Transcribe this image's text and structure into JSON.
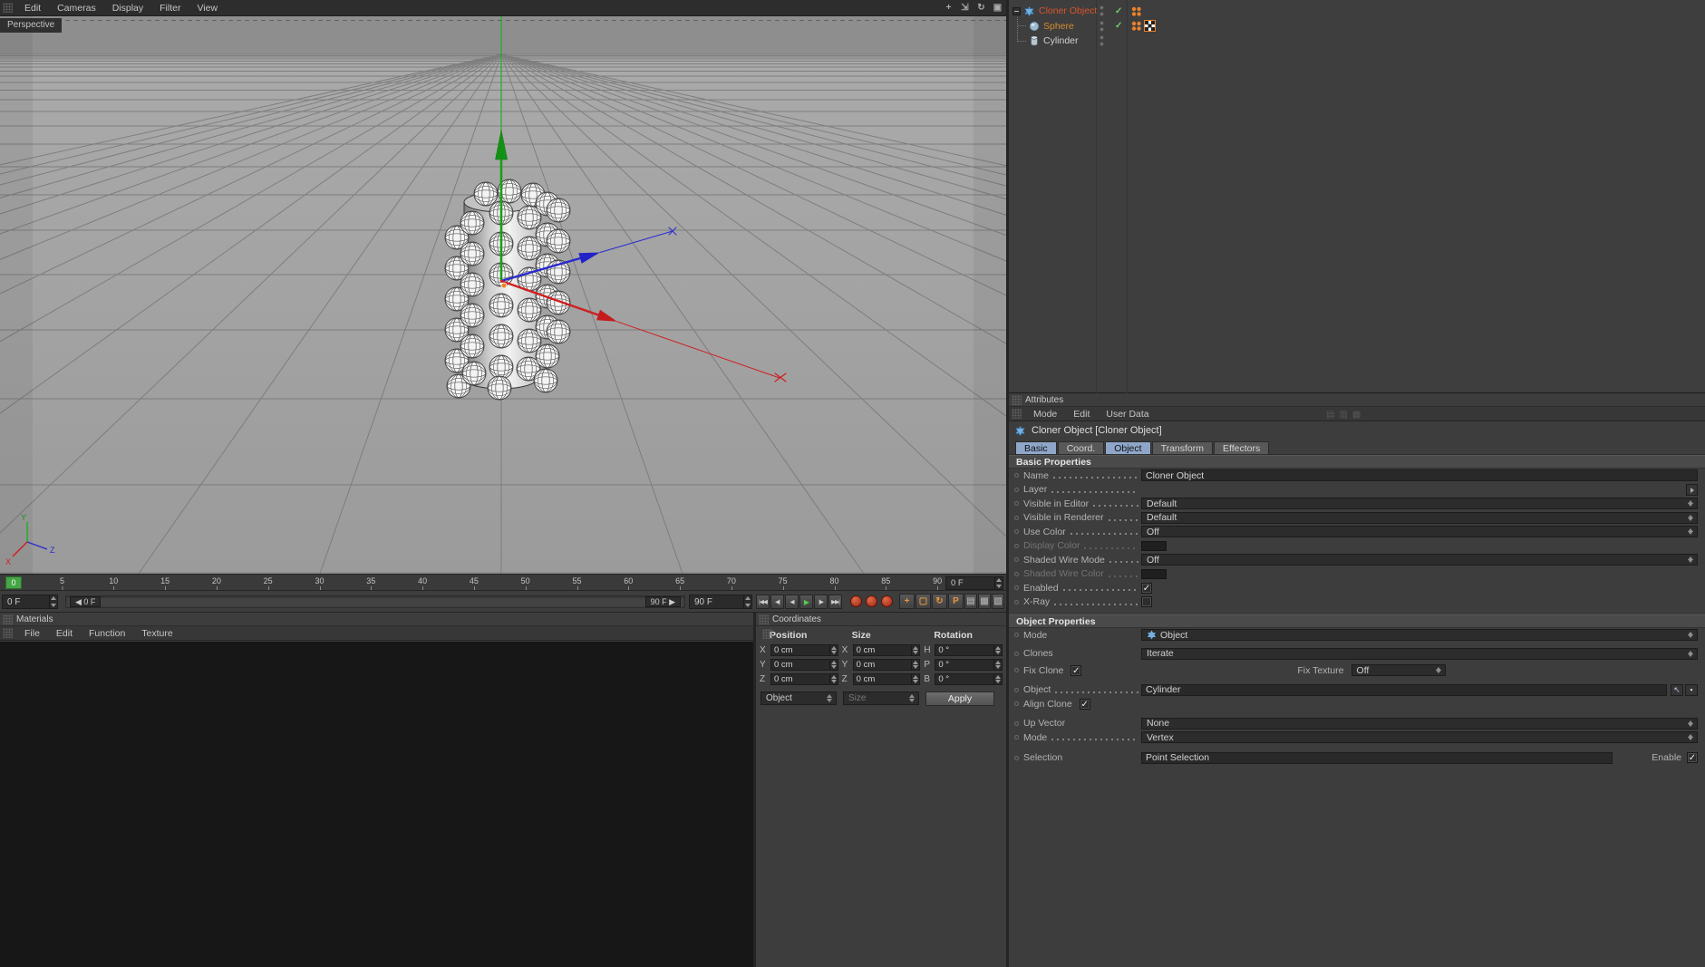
{
  "viewport": {
    "menu": [
      {
        "name": "edit",
        "label": "Edit"
      },
      {
        "name": "cameras",
        "label": "Cameras"
      },
      {
        "name": "display",
        "label": "Display"
      },
      {
        "name": "filter",
        "label": "Filter"
      },
      {
        "name": "view",
        "label": "View"
      }
    ],
    "view_label": "Perspective",
    "axis_labels": {
      "x": "X",
      "y": "Y",
      "z": "Z"
    },
    "nav_icons": [
      {
        "name": "pan-icon",
        "glyph": "+"
      },
      {
        "name": "zoom-icon",
        "glyph": "⇲"
      },
      {
        "name": "rotate-icon",
        "glyph": "↻"
      },
      {
        "name": "toggle-view-icon",
        "glyph": "▣"
      }
    ]
  },
  "object_manager": {
    "items": [
      {
        "name": "cloner-object",
        "label": "Cloner Object",
        "color": "#d8552a"
      },
      {
        "name": "sphere",
        "label": "Sphere",
        "color": "#d68c2e"
      },
      {
        "name": "cylinder",
        "label": "Cylinder",
        "color": "#d2d2d2"
      }
    ],
    "check": "✓"
  },
  "timeline": {
    "marker_label": "0",
    "ticks": [
      "5",
      "10",
      "15",
      "20",
      "25",
      "30",
      "35",
      "40",
      "45",
      "50",
      "55",
      "60",
      "65",
      "70",
      "75",
      "80",
      "85",
      "90"
    ],
    "ruler_frame": "0 F",
    "current_frame": "0 F",
    "range_start": "◀ 0 F",
    "range_end": "90 F ▶",
    "end_frame": "90 F",
    "transport": [
      {
        "name": "goto-start-button",
        "glyph": "|◀◀"
      },
      {
        "name": "prev-key-button",
        "glyph": "◀|"
      },
      {
        "name": "prev-frame-button",
        "glyph": "◀"
      },
      {
        "name": "play-button",
        "glyph": "▶",
        "accent": true
      },
      {
        "name": "next-frame-button",
        "glyph": "|▶"
      },
      {
        "name": "goto-end-button",
        "glyph": "▶▶|"
      }
    ],
    "record_buttons": [
      {
        "name": "record-keyframe-button"
      },
      {
        "name": "autokeying-button"
      },
      {
        "name": "keyframe-selection-button"
      }
    ],
    "record_toggles": [
      {
        "name": "record-position-toggle",
        "glyph": "+"
      },
      {
        "name": "record-scale-toggle",
        "glyph": "▢"
      },
      {
        "name": "record-rotation-toggle",
        "glyph": "↻"
      },
      {
        "name": "record-parameter-toggle",
        "glyph": "P"
      }
    ],
    "extra_toggles": [
      {
        "name": "motion-mode-icon",
        "glyph": "▤"
      },
      {
        "name": "key-interpolation-icon",
        "glyph": "▦"
      },
      {
        "name": "timeline-options-icon",
        "glyph": "▧"
      }
    ]
  },
  "materials": {
    "title": "Materials",
    "menu": [
      {
        "name": "file",
        "label": "File"
      },
      {
        "name": "edit",
        "label": "Edit"
      },
      {
        "name": "function",
        "label": "Function"
      },
      {
        "name": "texture",
        "label": "Texture"
      }
    ]
  },
  "coordinates": {
    "title": "Coordinates",
    "columns": [
      {
        "header": "Position",
        "rows": [
          {
            "axis": "X",
            "value": "0 cm"
          },
          {
            "axis": "Y",
            "value": "0 cm"
          },
          {
            "axis": "Z",
            "value": "0 cm"
          }
        ]
      },
      {
        "header": "Size",
        "rows": [
          {
            "axis": "X",
            "value": "0 cm"
          },
          {
            "axis": "Y",
            "value": "0 cm"
          },
          {
            "axis": "Z",
            "value": "0 cm"
          }
        ]
      },
      {
        "header": "Rotation",
        "rows": [
          {
            "axis": "H",
            "value": "0 °"
          },
          {
            "axis": "P",
            "value": "0 °"
          },
          {
            "axis": "B",
            "value": "0 °"
          }
        ]
      }
    ],
    "object_dropdown": "Object",
    "size_dropdown": "Size",
    "apply_button": "Apply"
  },
  "attributes": {
    "title": "Attributes",
    "menu": [
      {
        "name": "mode",
        "label": "Mode"
      },
      {
        "name": "edit",
        "label": "Edit"
      },
      {
        "name": "user-data",
        "label": "User Data"
      }
    ],
    "menu_icons": [
      {
        "name": "lock-icon",
        "glyph": "▤"
      },
      {
        "name": "history-back-icon",
        "glyph": "▥"
      },
      {
        "name": "history-forward-icon",
        "glyph": "▦"
      }
    ],
    "object_title": "Cloner Object [Cloner Object]",
    "tabs": [
      {
        "name": "basic",
        "label": "Basic",
        "selected": true
      },
      {
        "name": "coord",
        "label": "Coord.",
        "selected": false
      },
      {
        "name": "object",
        "label": "Object",
        "selected": true
      },
      {
        "name": "transform",
        "label": "Transform",
        "selected": false
      },
      {
        "name": "effectors",
        "label": "Effectors",
        "selected": false
      }
    ],
    "section_basic": "Basic Properties",
    "section_object": "Object Properties",
    "basic": {
      "name_label": "Name",
      "name_value": "Cloner Object",
      "layer_label": "Layer",
      "visible_editor_label": "Visible in Editor",
      "visible_editor_value": "Default",
      "visible_renderer_label": "Visible in Renderer",
      "visible_renderer_value": "Default",
      "use_color_label": "Use Color",
      "use_color_value": "Off",
      "display_color_label": "Display Color",
      "shaded_wire_mode_label": "Shaded Wire Mode",
      "shaded_wire_mode_value": "Off",
      "shaded_wire_color_label": "Shaded Wire Color",
      "enabled_label": "Enabled",
      "enabled_check": "✓",
      "xray_label": "X-Ray",
      "xray_check": ""
    },
    "object": {
      "mode_label": "Mode",
      "mode_value": "Object",
      "clones_label": "Clones",
      "clones_value": "Iterate",
      "fix_clone_label": "Fix Clone",
      "fix_clone_check": "✓",
      "fix_texture_label": "Fix Texture",
      "fix_texture_value": "Off",
      "object_label": "Object",
      "object_value": "Cylinder",
      "object_btn1": "↖",
      "object_btn2": "▪",
      "align_clone_label": "Align Clone",
      "align_clone_check": "✓",
      "up_vector_label": "Up Vector",
      "up_vector_value": "None",
      "mode2_label": "Mode",
      "mode2_value": "Vertex",
      "selection_label": "Selection",
      "selection_value": "Point Selection",
      "enable_label": "Enable",
      "enable_check": "✓"
    }
  }
}
